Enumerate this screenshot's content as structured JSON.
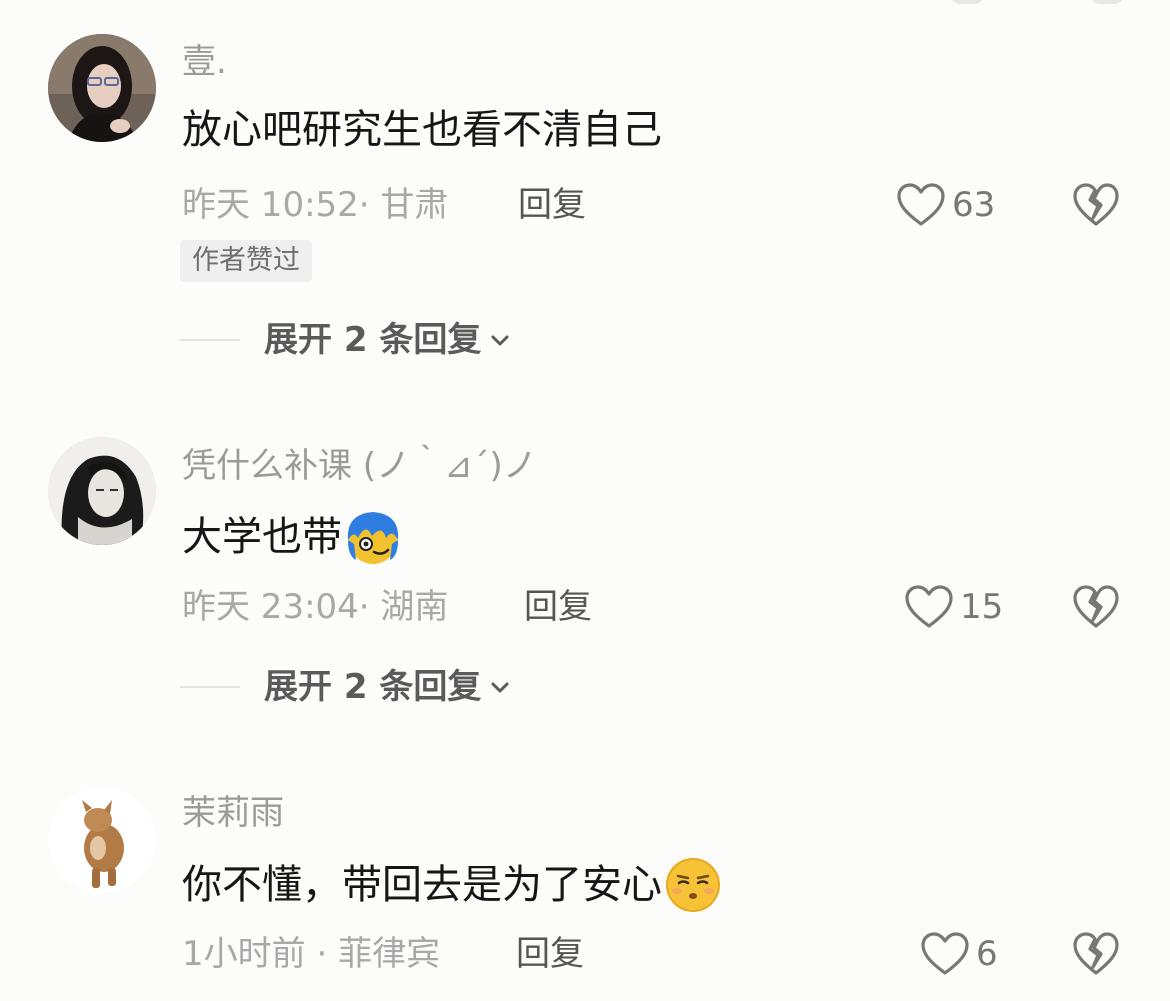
{
  "comments": [
    {
      "username": "壹.",
      "content": "放心吧研究生也看不清自己",
      "time": "昨天 10:52",
      "location": "甘肃",
      "reply_label": "回复",
      "likes": "63",
      "badge": "作者赞过",
      "expand_label": "展开 2 条回复"
    },
    {
      "username": "凭什么补课 (ノ｀⊿´)ノ",
      "content": "大学也带",
      "emoji": "blue-hair-face-emoji",
      "time": "昨天 23:04",
      "location": "湖南",
      "reply_label": "回复",
      "likes": "15",
      "expand_label": "展开 2 条回复"
    },
    {
      "username": "茉莉雨",
      "content": "你不懂，带回去是为了安心",
      "emoji": "smug-face-emoji",
      "time": "1小时前",
      "location": "菲律宾",
      "reply_label": "回复",
      "likes": "6"
    }
  ],
  "icons": {
    "like": "heart-outline-icon",
    "dislike": "broken-heart-icon",
    "expand": "chevron-down-icon"
  },
  "colors": {
    "background": "#fcfcfa",
    "text_primary": "#161616",
    "text_secondary": "#a8a8a8"
  }
}
